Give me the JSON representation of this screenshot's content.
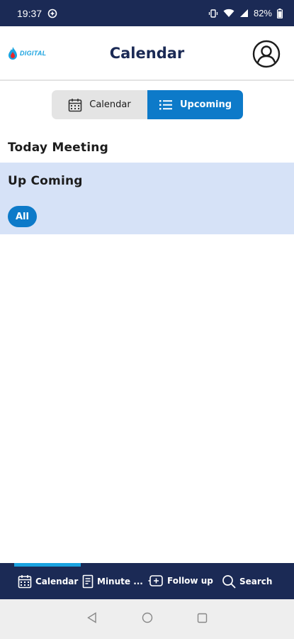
{
  "status_bar": {
    "time": "19:37",
    "battery": "82%",
    "icons": [
      "data-saver-icon",
      "vibrate-icon",
      "wifi-icon",
      "signal-icon",
      "battery-icon"
    ]
  },
  "header": {
    "logo_text": "DIGITAL",
    "title": "Calendar",
    "profile_icon": "user-circle-icon"
  },
  "segment": {
    "calendar_label": "Calendar",
    "upcoming_label": "Upcoming",
    "active": "Upcoming"
  },
  "sections": {
    "today_title": "Today Meeting",
    "upcoming_title": "Up Coming",
    "filter_chip": "All"
  },
  "tab_bar": {
    "tabs": [
      {
        "label": "Calendar",
        "icon": "calendar-icon"
      },
      {
        "label": "Minute ...",
        "icon": "document-icon"
      },
      {
        "label": "Follow up",
        "icon": "follow-up-icon"
      },
      {
        "label": "Search",
        "icon": "search-icon"
      }
    ],
    "active": "Calendar"
  },
  "colors": {
    "navy": "#1b2a55",
    "accent_blue": "#0d7ac9",
    "light_blue": "#1aa3e0",
    "section_bg": "#d6e2f7"
  }
}
